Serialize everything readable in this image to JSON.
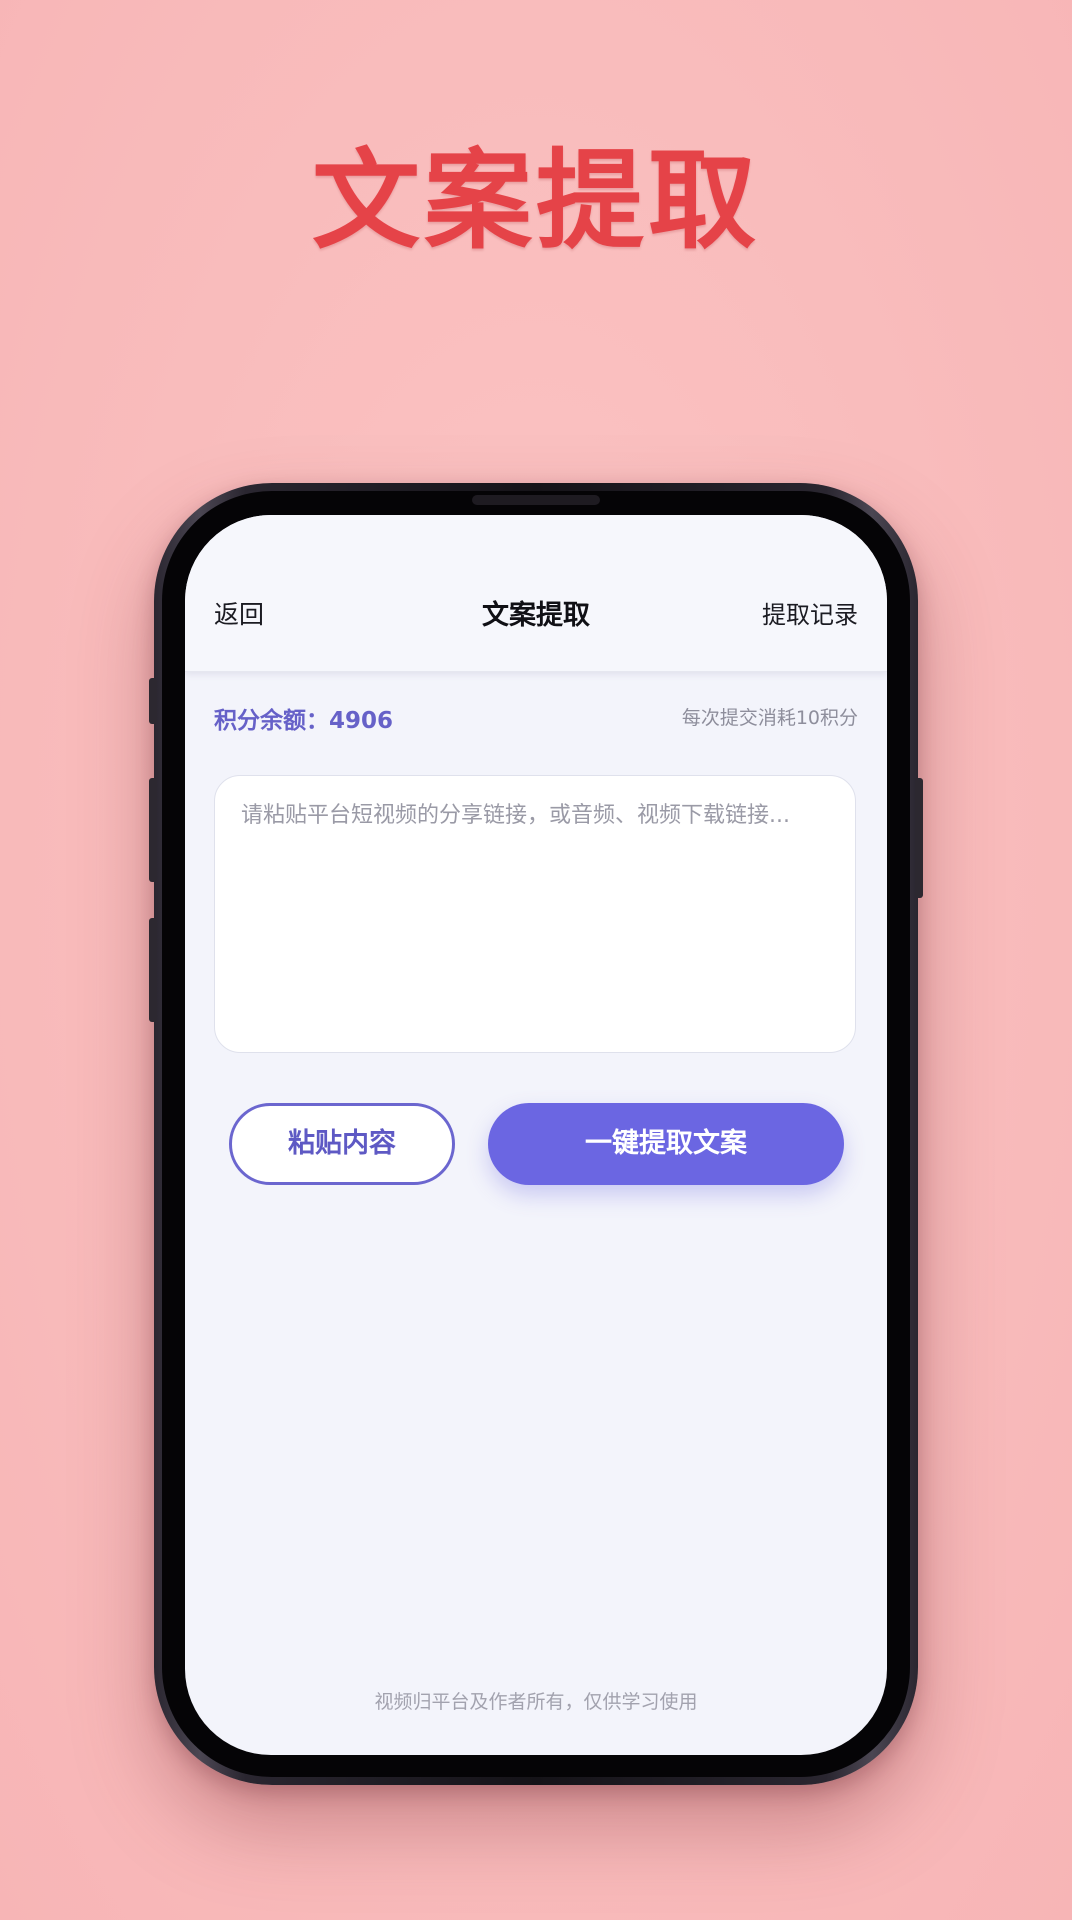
{
  "hero": {
    "title": "文案提取"
  },
  "nav": {
    "back_label": "返回",
    "title": "文案提取",
    "history_label": "提取记录"
  },
  "points": {
    "balance_text": "积分余额：4906",
    "balance_value": 4906,
    "cost_text": "每次提交消耗10积分"
  },
  "input": {
    "value": "",
    "placeholder": "请粘贴平台短视频的分享链接，或音频、视频下载链接..."
  },
  "actions": {
    "paste_label": "粘贴内容",
    "extract_label": "一键提取文案"
  },
  "footer": {
    "note": "视频归平台及作者所有，仅供学习使用"
  },
  "colors": {
    "background": "#f9bcbc",
    "hero_title": "#e54348",
    "accent": "#6b66e2",
    "screen_bg": "#f3f4fb"
  }
}
